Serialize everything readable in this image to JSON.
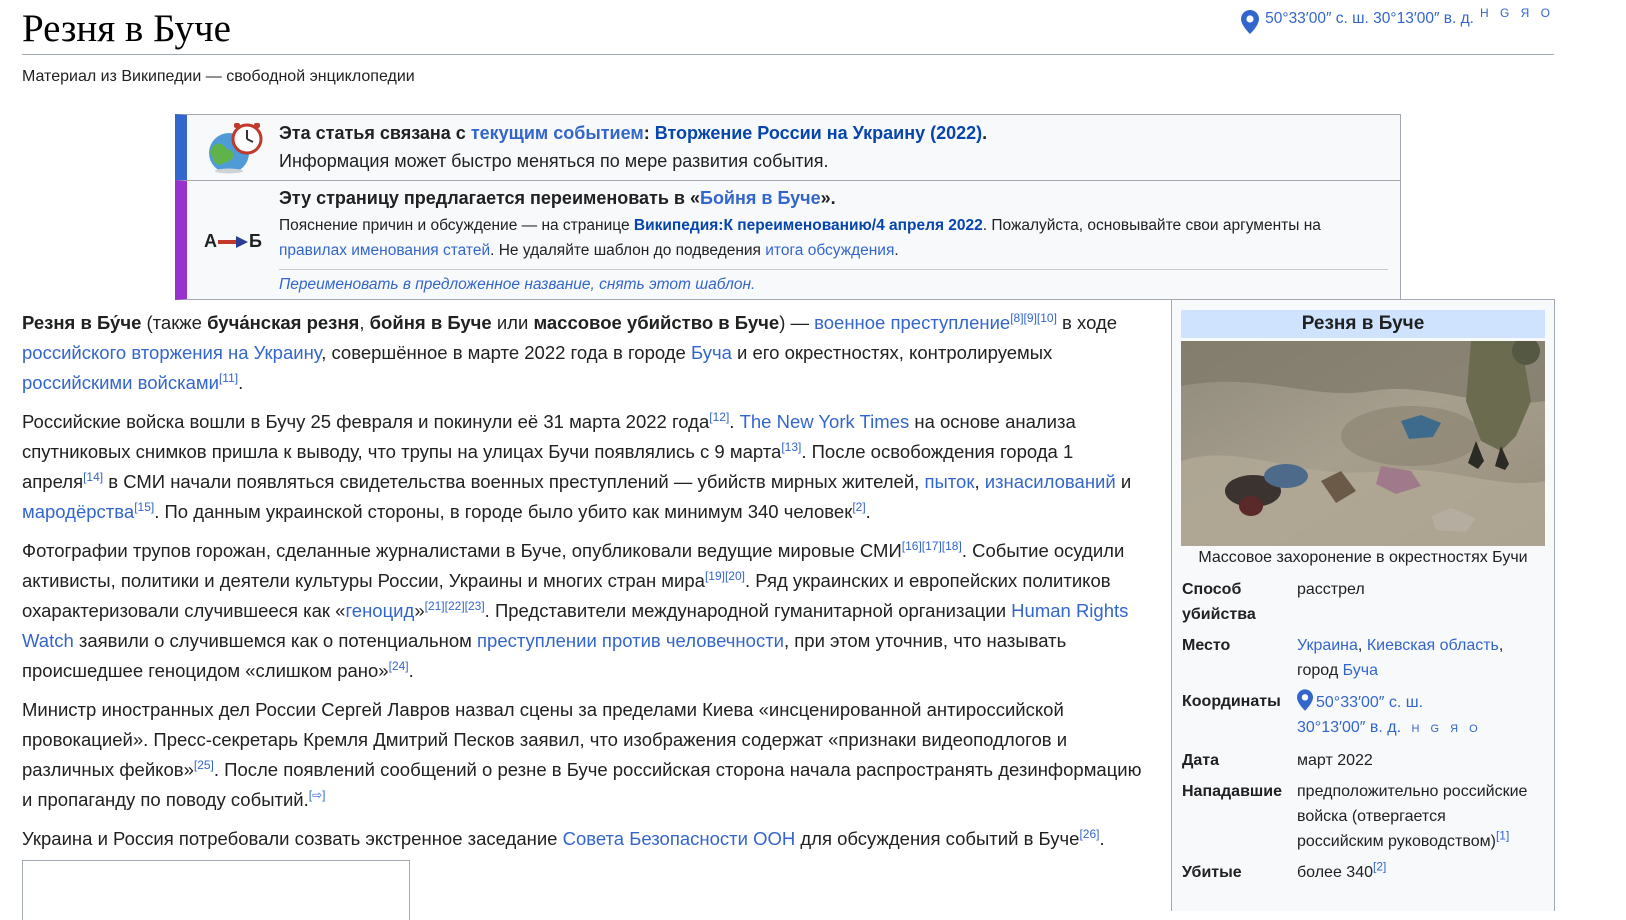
{
  "page": {
    "title": "Резня в Буче",
    "tagline": "Материал из Википедии — свободной энциклопедии",
    "coords": "50°33′00″ с. ш. 30°13′00″ в. д.",
    "coords_links": "H G Я O"
  },
  "current_event": {
    "lead": "Эта статья связана с ",
    "link1": "текущим событием",
    "colon": ": ",
    "link2": "Вторжение России на Украину (2022)",
    "end": ".",
    "sub": "Информация может быстро меняться по мере развития события."
  },
  "rename": {
    "icon_a": "А",
    "icon_b": "Б",
    "lead": "Эту страницу предлагается переименовать в «",
    "link": "Бойня в Буче",
    "end": "».",
    "l1": "Пояснение причин и обсуждение — на странице ",
    "l1_link": "Википедия:К переименованию/4 апреля 2022",
    "l1_end": ". Пожалуйста, основывайте свои аргументы на",
    "l2_link": "правилах именования статей",
    "l2_mid": ". Не удаляйте шаблон до подведения ",
    "l2_link2": "итога обсуждения",
    "l2_end": ".",
    "action": "Переименовать в предложенное название, снять этот шаблон."
  },
  "paragraphs": {
    "p1": {
      "b1": "Резня в Бу́че",
      "t1": " (также ",
      "b2": "буча́нская резня",
      "t2": ", ",
      "b3": "бойня в Буче",
      "t3": " или ",
      "b4": "массовое убийство в Буче",
      "t4": ") — ",
      "l1": "военное преступление",
      "s1": "[8][9][10]",
      "t5": " в ходе",
      "l2": "российского вторжения на Украину",
      "t6": ", совершённое в марте 2022 года в городе ",
      "l3": "Буча",
      "t7": " и его окрестностях, контролируемых",
      "l4": "российскими войсками",
      "s2": "[11]",
      "t8": "."
    },
    "p2": {
      "t1": "Российские войска вошли в Бучу 25 февраля и покинули её 31 марта 2022 года",
      "s1": "[12]",
      "t2": ". ",
      "l1": "The New York Times",
      "t3": " на основе анализа",
      "t4": "спутниковых снимков пришла к выводу, что трупы на улицах Бучи появлялись с 9 марта",
      "s2": "[13]",
      "t5": ". После освобождения города 1",
      "t6": "апреля",
      "s3": "[14]",
      "t7": " в СМИ начали появляться свидетельства военных преступлений — убийств мирных жителей, ",
      "l2": "пыток",
      "t8": ", ",
      "l3": "изнасилований",
      "t9": " и",
      "l4": "мародёрства",
      "s4": "[15]",
      "t10": ". По данным украинской стороны, в городе было убито как минимум 340 человек",
      "s5": "[2]",
      "t11": "."
    },
    "p3": {
      "t1": "Фотографии трупов горожан, сделанные журналистами в Буче, опубликовали ведущие мировые СМИ",
      "s1": "[16][17][18]",
      "t2": ". Событие осудили",
      "t3": "активисты, политики и деятели культуры России, Украины и многих стран мира",
      "s2": "[19][20]",
      "t4": ". Ряд украинских и европейских политиков",
      "t5": "охарактеризовали случившееся как «",
      "l1": "геноцид",
      "t6": "»",
      "s3": "[21][22][23]",
      "t7": ". Представители международной гуманитарной организации ",
      "l2": "Human Rights",
      "l3": "Watch",
      "t8": " заявили о случившемся как о потенциальном ",
      "l4": "преступлении против человечности",
      "t9": ", при этом уточнив, что называть",
      "t10": "происшедшее геноцидом «слишком рано»",
      "s4": "[24]",
      "t11": "."
    },
    "p4": {
      "t1": "Министр иностранных дел России Сергей Лавров назвал сцены за пределами Киева «инсценированной антироссийской",
      "t2": "провокацией». Пресс-секретарь Кремля Дмитрий Песков заявил, что изображения содержат «признаки видеоподлогов и",
      "t3": "различных фейков»",
      "s1": "[25]",
      "t4": ". После появлений сообщений о резне в Буче российская сторона начала распространять дезинформацию",
      "t5": "и пропаганду по поводу событий.",
      "s2": "[⇨]"
    },
    "p5": {
      "t1": "Украина и Россия потребовали созвать экстренное заседание ",
      "l1": "Совета Безопасности ООН",
      "t2": " для обсуждения событий в Буче",
      "s1": "[26]",
      "t3": "."
    }
  },
  "infobox": {
    "title": "Резня в Буче",
    "caption": "Массовое захоронение в окрестностях Бучи",
    "method_label_1": "Способ",
    "method_label_2": "убийства",
    "method_value": "расстрел",
    "place_label": "Место",
    "place_l1": "Украина",
    "place_sep": ", ",
    "place_l2": "Киевская область",
    "place_sep2": ",",
    "place_t": "город ",
    "place_l3": "Буча",
    "coords_label": "Координаты",
    "coords_1": "50°33′00″ с. ш.",
    "coords_2": "30°13′00″ в. д.",
    "coords_links": "H G Я O",
    "date_label": "Дата",
    "date_value": "март 2022",
    "attackers_label": "Нападавшие",
    "attackers_1": "предположительно российские",
    "attackers_2": "войска (отвергается",
    "attackers_3": "российским руководством)",
    "attackers_sup": "[1]",
    "killed_label": "Убитые",
    "killed_value": "более 340",
    "killed_sup": "[2]"
  },
  "colors": {
    "link": "#3366cc",
    "current_event_bar": "#3366cc",
    "rename_bar": "#9932cc",
    "infobox_header": "#cfe3ff"
  },
  "icons": [
    "location-pin-icon",
    "globe-clock-icon",
    "rename-arrow-icon"
  ]
}
